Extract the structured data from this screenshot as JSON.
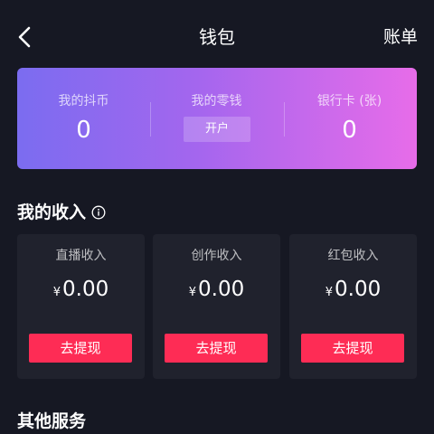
{
  "header": {
    "title": "钱包",
    "bill_label": "账单"
  },
  "wallet_summary": {
    "items": [
      {
        "label": "我的抖币",
        "value": "0"
      },
      {
        "label": "我的零钱",
        "button_label": "开户"
      },
      {
        "label": "银行卡 (张)",
        "value": "0"
      }
    ]
  },
  "income": {
    "title": "我的收入",
    "cards": [
      {
        "label": "直播收入",
        "currency": "¥",
        "amount": "0.00",
        "button_label": "去提现"
      },
      {
        "label": "创作收入",
        "currency": "¥",
        "amount": "0.00",
        "button_label": "去提现"
      },
      {
        "label": "红包收入",
        "currency": "¥",
        "amount": "0.00",
        "button_label": "去提现"
      }
    ]
  },
  "services": {
    "title": "其他服务"
  },
  "colors": {
    "background": "#161823",
    "card_background": "#20222d",
    "accent_button": "#fe2c55",
    "gradient_start": "#7b6cf0",
    "gradient_end": "#e76ce9"
  },
  "icons": {
    "back": "chevron-left-icon",
    "info": "info-circle-icon"
  }
}
